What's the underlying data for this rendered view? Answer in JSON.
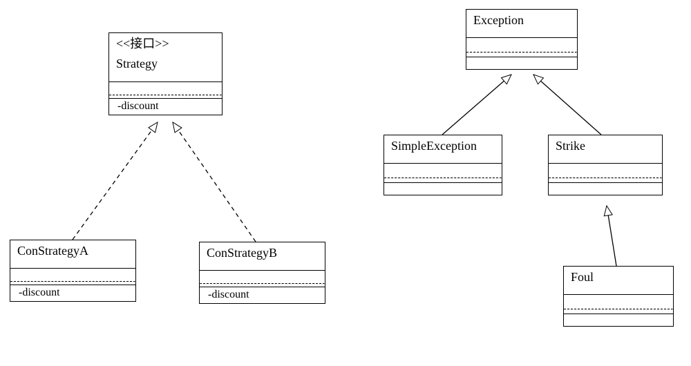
{
  "diagram": {
    "left": {
      "interface_box": {
        "stereotype": "<<接口>>",
        "name": "Strategy",
        "operation": "-discount"
      },
      "con_a": {
        "name": "ConStrategyA",
        "operation": "-discount"
      },
      "con_b": {
        "name": "ConStrategyB",
        "operation": "-discount"
      }
    },
    "right": {
      "exception": {
        "name": "Exception"
      },
      "simple_exception": {
        "name": "SimpleException"
      },
      "strike": {
        "name": "Strike"
      },
      "foul": {
        "name": "Foul"
      }
    }
  }
}
